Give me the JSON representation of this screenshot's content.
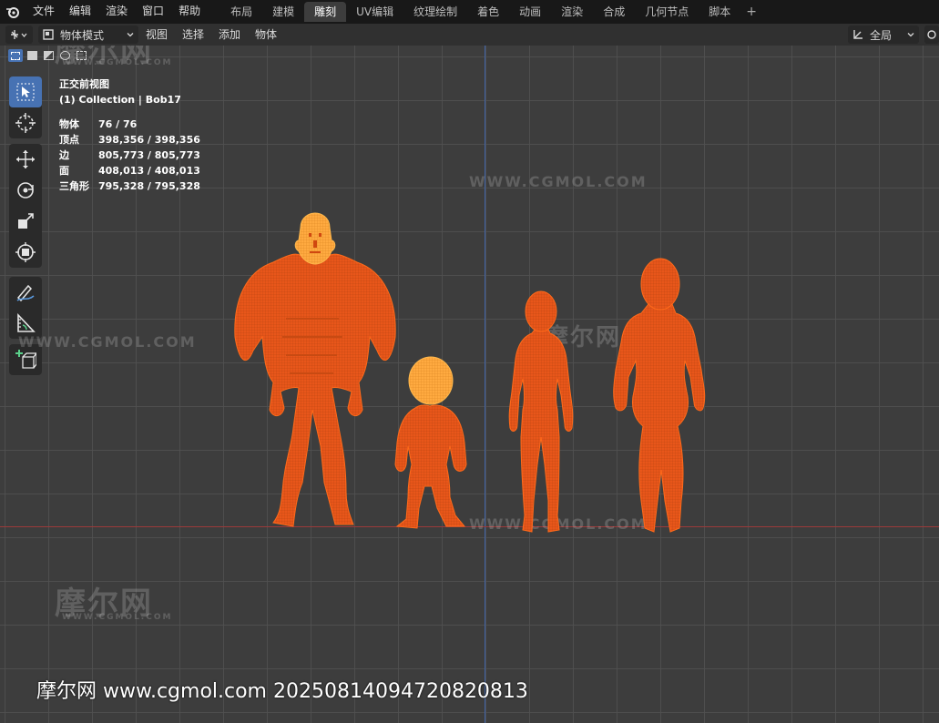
{
  "menu": [
    "文件",
    "编辑",
    "渲染",
    "窗口",
    "帮助"
  ],
  "workspaces": [
    "布局",
    "建模",
    "雕刻",
    "UV编辑",
    "纹理绘制",
    "着色",
    "动画",
    "渲染",
    "合成",
    "几何节点",
    "脚本"
  ],
  "active_workspace": "雕刻",
  "add_tab": "+",
  "header": {
    "mode": "物体模式",
    "menus": [
      "视图",
      "选择",
      "添加",
      "物体"
    ],
    "transform_orientation": "全局"
  },
  "overlay": {
    "view_name": "正交前视图",
    "collection": "(1) Collection | Bob17",
    "stats": [
      {
        "label": "物体",
        "value": "76 / 76"
      },
      {
        "label": "顶点",
        "value": "398,356 / 398,356"
      },
      {
        "label": "边",
        "value": "805,773 / 805,773"
      },
      {
        "label": "面",
        "value": "408,013 / 408,013"
      },
      {
        "label": "三角形",
        "value": "795,328 / 795,328"
      }
    ]
  },
  "watermarks": {
    "cn": "摩尔网",
    "url": "WWW.CGMOL.COM",
    "small_url": "CGMOL.COM",
    "bottom": "摩尔网 www.cgmol.com 20250814094720820813"
  },
  "colors": {
    "selection_orange": "#e8561a",
    "active_orange": "#ffaa40",
    "x_axis": "#9b3a3a",
    "z_axis": "#3f63a8",
    "active_tool": "#4772b3"
  }
}
